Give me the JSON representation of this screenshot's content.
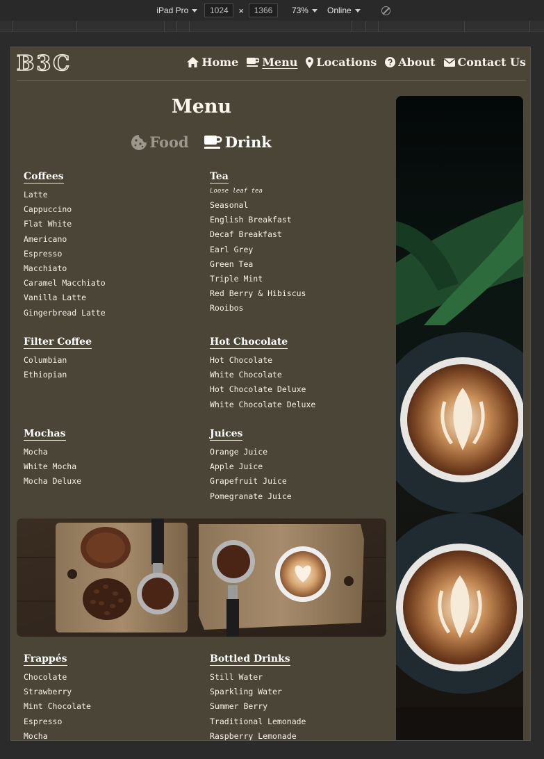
{
  "devtools": {
    "device": "iPad Pro",
    "width": "1024",
    "height": "1366",
    "dimension_separator": "×",
    "zoom": "73%",
    "throttle": "Online"
  },
  "header": {
    "logo_letters": [
      "B",
      "3",
      "C"
    ],
    "nav": [
      {
        "label": "Home",
        "icon": "home-icon",
        "active": false
      },
      {
        "label": "Menu",
        "icon": "coffee-cup-icon",
        "active": true
      },
      {
        "label": "Locations",
        "icon": "map-pin-icon",
        "active": false
      },
      {
        "label": "About",
        "icon": "question-circle-icon",
        "active": false
      },
      {
        "label": "Contact Us",
        "icon": "envelope-icon",
        "active": false
      }
    ]
  },
  "main": {
    "title": "Menu",
    "toggle": {
      "food": {
        "label": "Food",
        "icon": "cookie-icon"
      },
      "drink": {
        "label": "Drink",
        "icon": "coffee-cup-icon"
      }
    },
    "sections": [
      {
        "title": "Coffees",
        "subtitle": "",
        "items": [
          "Latte",
          "Cappuccino",
          "Flat White",
          "Americano",
          "Espresso",
          "Macchiato",
          "Caramel Macchiato",
          "Vanilla Latte",
          "Gingerbread Latte"
        ]
      },
      {
        "title": "Tea",
        "subtitle": "Loose leaf tea",
        "items": [
          "Seasonal",
          "English Breakfast",
          "Decaf Breakfast",
          "Earl Grey",
          "Green Tea",
          "Triple Mint",
          "Red Berry & Hibiscus",
          "Rooibos"
        ]
      },
      {
        "title": "Filter Coffee",
        "subtitle": "",
        "items": [
          "Columbian",
          "Ethiopian"
        ]
      },
      {
        "title": "Hot Chocolate",
        "subtitle": "",
        "items": [
          "Hot Chocolate",
          "White Chocolate",
          "Hot Chocolate Deluxe",
          "White Chocolate Deluxe"
        ]
      },
      {
        "title": "Mochas",
        "subtitle": "",
        "items": [
          "Mocha",
          "White Mocha",
          "Mocha Deluxe"
        ]
      },
      {
        "title": "Juices",
        "subtitle": "",
        "items": [
          "Orange Juice",
          "Apple Juice",
          "Grapefruit Juice",
          "Pomegranate Juice"
        ]
      },
      {
        "title": "Frappés",
        "subtitle": "",
        "items": [
          "Chocolate",
          "Strawberry",
          "Mint Chocolate",
          "Espresso",
          "Mocha"
        ]
      },
      {
        "title": "Bottled Drinks",
        "subtitle": "",
        "items": [
          "Still Water",
          "Sparkling Water",
          "Summer Berry",
          "Traditional Lemonade",
          "Raspberry Lemonade"
        ]
      }
    ]
  },
  "colors": {
    "page_bg": "#4b4538",
    "text": "#f1ede4",
    "inactive_toggle": "#9b978d",
    "devtools_bg": "#292929"
  }
}
